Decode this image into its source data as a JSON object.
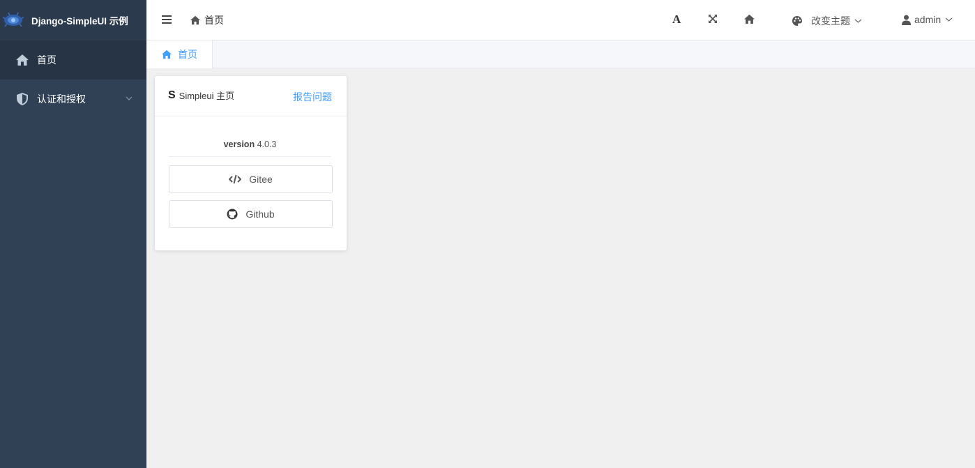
{
  "brand": {
    "title": "Django-SimpleUI 示例"
  },
  "sidebar": {
    "items": [
      {
        "label": "首页",
        "icon": "home-icon",
        "active": true
      },
      {
        "label": "认证和授权",
        "icon": "shield-icon",
        "active": false,
        "expandable": true
      }
    ]
  },
  "header": {
    "breadcrumb": "首页",
    "font_tool_label": "A",
    "theme_label": "改变主题",
    "user_label": "admin"
  },
  "tabs": [
    {
      "label": "首页",
      "icon": "home-icon",
      "active": true
    }
  ],
  "card": {
    "logo_letter": "S",
    "title": "Simpleui 主页",
    "link": "报告问题",
    "version_key": "version",
    "version_value": "4.0.3",
    "buttons": [
      {
        "label": "Gitee",
        "icon": "code-icon"
      },
      {
        "label": "Github",
        "icon": "github-icon"
      }
    ]
  },
  "colors": {
    "sidebar_bg": "#304156",
    "accent": "#409eff",
    "page_bg": "#f0f0f0"
  }
}
